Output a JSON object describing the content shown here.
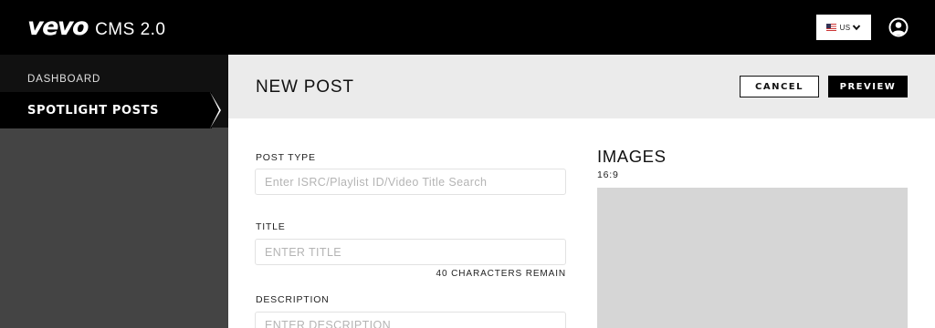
{
  "header": {
    "logo_text": "vevo",
    "app_name": "CMS 2.0",
    "locale": {
      "label": "US",
      "flag_icon": "us-flag-icon",
      "chevron_icon": "chevron-down-icon"
    },
    "user_icon": "user-circle-icon"
  },
  "sidebar": {
    "items": [
      {
        "label": "DASHBOARD",
        "active": false
      },
      {
        "label": "SPOTLIGHT POSTS",
        "active": true
      }
    ]
  },
  "page": {
    "title": "NEW POST",
    "actions": {
      "cancel_label": "CANCEL",
      "preview_label": "PREVIEW"
    }
  },
  "form": {
    "post_type": {
      "label": "POST TYPE",
      "placeholder": "Enter ISRC/Playlist ID/Video Title Search",
      "value": ""
    },
    "title": {
      "label": "TITLE",
      "placeholder": "ENTER TITLE",
      "value": "",
      "counter": "40 CHARACTERS REMAIN"
    },
    "description": {
      "label": "DESCRIPTION",
      "placeholder": "ENTER DESCRIPTION",
      "value": ""
    }
  },
  "images": {
    "heading": "IMAGES",
    "ratio": "16:9"
  },
  "colors": {
    "topbar": "#000000",
    "sidebar": "#444444",
    "header_band": "#ebebeb",
    "image_placeholder": "#d6d6d6"
  }
}
